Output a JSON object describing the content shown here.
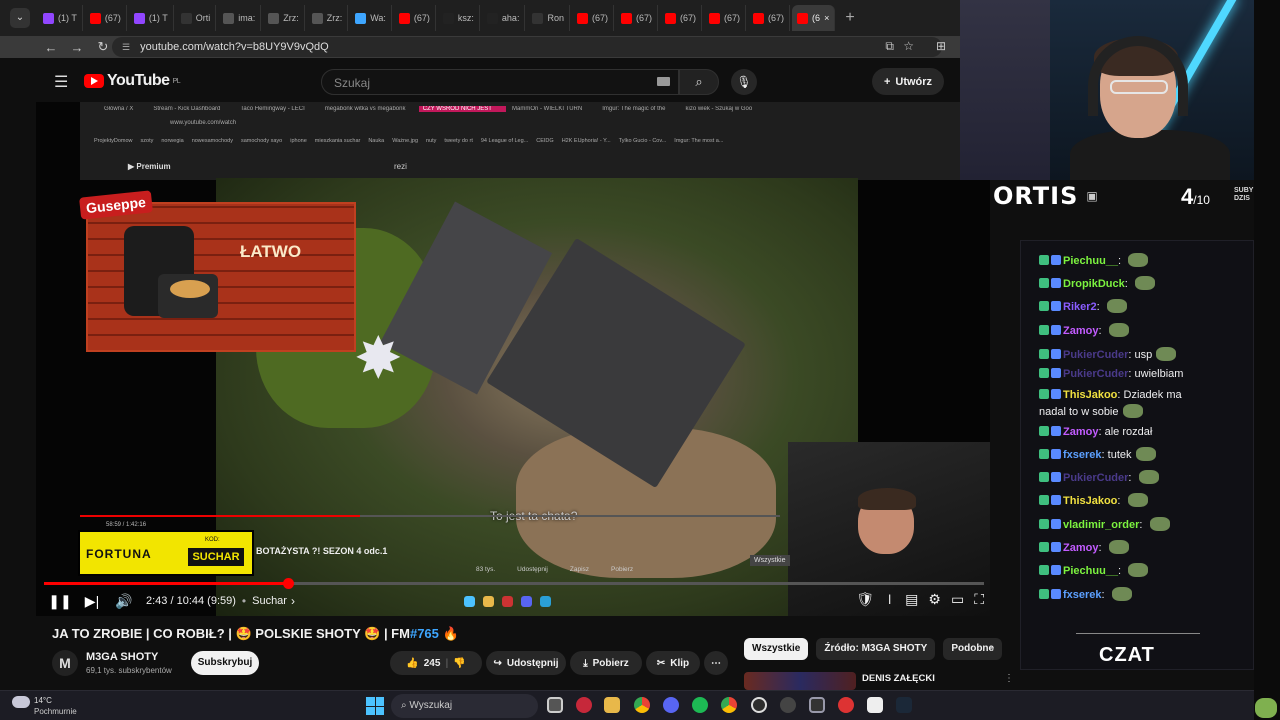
{
  "browser": {
    "tabs": [
      "(1) T",
      "(67)",
      "(1) T",
      "Orti",
      "ima:",
      "Zrz:",
      "Zrz:",
      "Wa:",
      "(67)",
      "ksz:",
      "aha:",
      "Ron",
      "(67)",
      "(67)",
      "(67)",
      "(67)",
      "(67)",
      "(6"
    ],
    "url": "youtube.com/watch?v=b8UY9V9vQdQ"
  },
  "youtube": {
    "logo": "YouTube",
    "logo_region": "PL",
    "search_placeholder": "Szukaj",
    "create_label": "Utwórz"
  },
  "inner_browser": {
    "tabs": [
      "Główna / X",
      "Stream - Kick Dashboard",
      "Taco Hemingway - LECI",
      "megabonk witka vs megabonk",
      "CZY WŚRÓD NICH JEST",
      "MammOn - WIELKI TURN",
      "Imgur: The magic of the",
      "kizo wiek - Szukaj w Goo"
    ],
    "url": "www.youtube.com/watch",
    "bookmarks": [
      "ProjektyDomow",
      "szoty",
      "norwegia",
      "nowesamochody",
      "samochody xayo",
      "iphone",
      "mieszkania suchar",
      "Nauka",
      "Ważne.jpg",
      "nuty",
      "tweety do rt",
      "94 League of Leg...",
      "CEIDG",
      "H2K EUphoria! - Y...",
      "Tylko Gucio - Cov...",
      "Imgur: The most a..."
    ],
    "search_query": "rezi",
    "premium_label": "Premium",
    "video_title_partial": "BOTAŻYSTA ?! SEZON 4 odc.1",
    "time": "58:59 / 1:42:16",
    "controls": [
      "83 tys.",
      "Udostępnij",
      "Zapisz",
      "Pobierz"
    ],
    "subtitle": "To jest ta chata?",
    "all_tag": "Wszystkie"
  },
  "overlay_ad": {
    "brand": "Guseppe",
    "text": "ŁATWO"
  },
  "fortuna": {
    "name": "FORTUNA",
    "kod_label": "KOD:",
    "code": "SUCHAR"
  },
  "player": {
    "progress": 0.26,
    "time": "2:43 / 10:44 (9:59)",
    "chapter": "Suchar"
  },
  "video": {
    "title": "JA TO ZROBIE | CO ROBIŁ? | 🤩 POLSKIE SHOTY 🤩 | FM",
    "tag": "#765",
    "fire": "🔥",
    "channel": "M3GA SHOTY",
    "channel_initial": "M",
    "subscribers": "69,1 tys. subskrybentów",
    "subscribe_label": "Subskrybuj",
    "likes": "245",
    "share_label": "Udostępnij",
    "download_label": "Pobierz",
    "clip_label": "Klip"
  },
  "related": {
    "chips": [
      "Wszystkie",
      "Źródło: M3GA SHOTY",
      "Podobne"
    ],
    "first_title": "DENIS ZAŁĘCKI"
  },
  "taskbar": {
    "temperature": "14°C",
    "weather": "Pochmurnie",
    "search_label": "Wyszukaj"
  },
  "stream": {
    "streamer": "ORTIS",
    "sub_count": "4",
    "sub_goal": "/10",
    "sub_label_1": "SUBY",
    "sub_label_2": "DZIS",
    "chat_title": "CZAT",
    "chat": [
      {
        "user": "Piechuu__",
        "text": "",
        "color": "#7cf23f",
        "emote": true
      },
      {
        "user": "DropikDuck",
        "text": "",
        "color": "#7cf23f",
        "emote": true
      },
      {
        "user": "Riker2",
        "text": "",
        "color": "#8a5cff",
        "emote": true
      },
      {
        "user": "Zamoy",
        "text": "",
        "color": "#c25cff",
        "emote": true
      },
      {
        "user": "PukierCuder",
        "text": "usp",
        "color": "#4a3a8a",
        "emote": true
      },
      {
        "user": "PukierCuder",
        "text": "uwielbiam",
        "color": "#4a3a8a",
        "emote": false
      },
      {
        "user": "ThisJakoo",
        "text": "Dziadek ma",
        "color": "#f0e040",
        "emote": false
      },
      {
        "user": "",
        "text": "nadal to w sobie",
        "color": "#ffffff",
        "emote": true
      },
      {
        "user": "Zamoy",
        "text": "ale rozdał",
        "color": "#c25cff",
        "emote": false
      },
      {
        "user": "fxserek",
        "text": "tutek",
        "color": "#5ca0ff",
        "emote": true
      },
      {
        "user": "PukierCuder",
        "text": "",
        "color": "#4a3a8a",
        "emote": true
      },
      {
        "user": "ThisJakoo",
        "text": "",
        "color": "#f0e040",
        "emote": true
      },
      {
        "user": "vladimir_order",
        "text": "",
        "color": "#7cf23f",
        "emote": true
      },
      {
        "user": "Zamoy",
        "text": "",
        "color": "#c25cff",
        "emote": true
      },
      {
        "user": "Piechuu__",
        "text": "",
        "color": "#7cf23f",
        "emote": true
      },
      {
        "user": "fxserek",
        "text": "",
        "color": "#5ca0ff",
        "emote": true
      }
    ]
  },
  "colors": {
    "yt_red": "#ff0000",
    "link_blue": "#3ea6ff",
    "fortuna_yellow": "#f2e500"
  }
}
